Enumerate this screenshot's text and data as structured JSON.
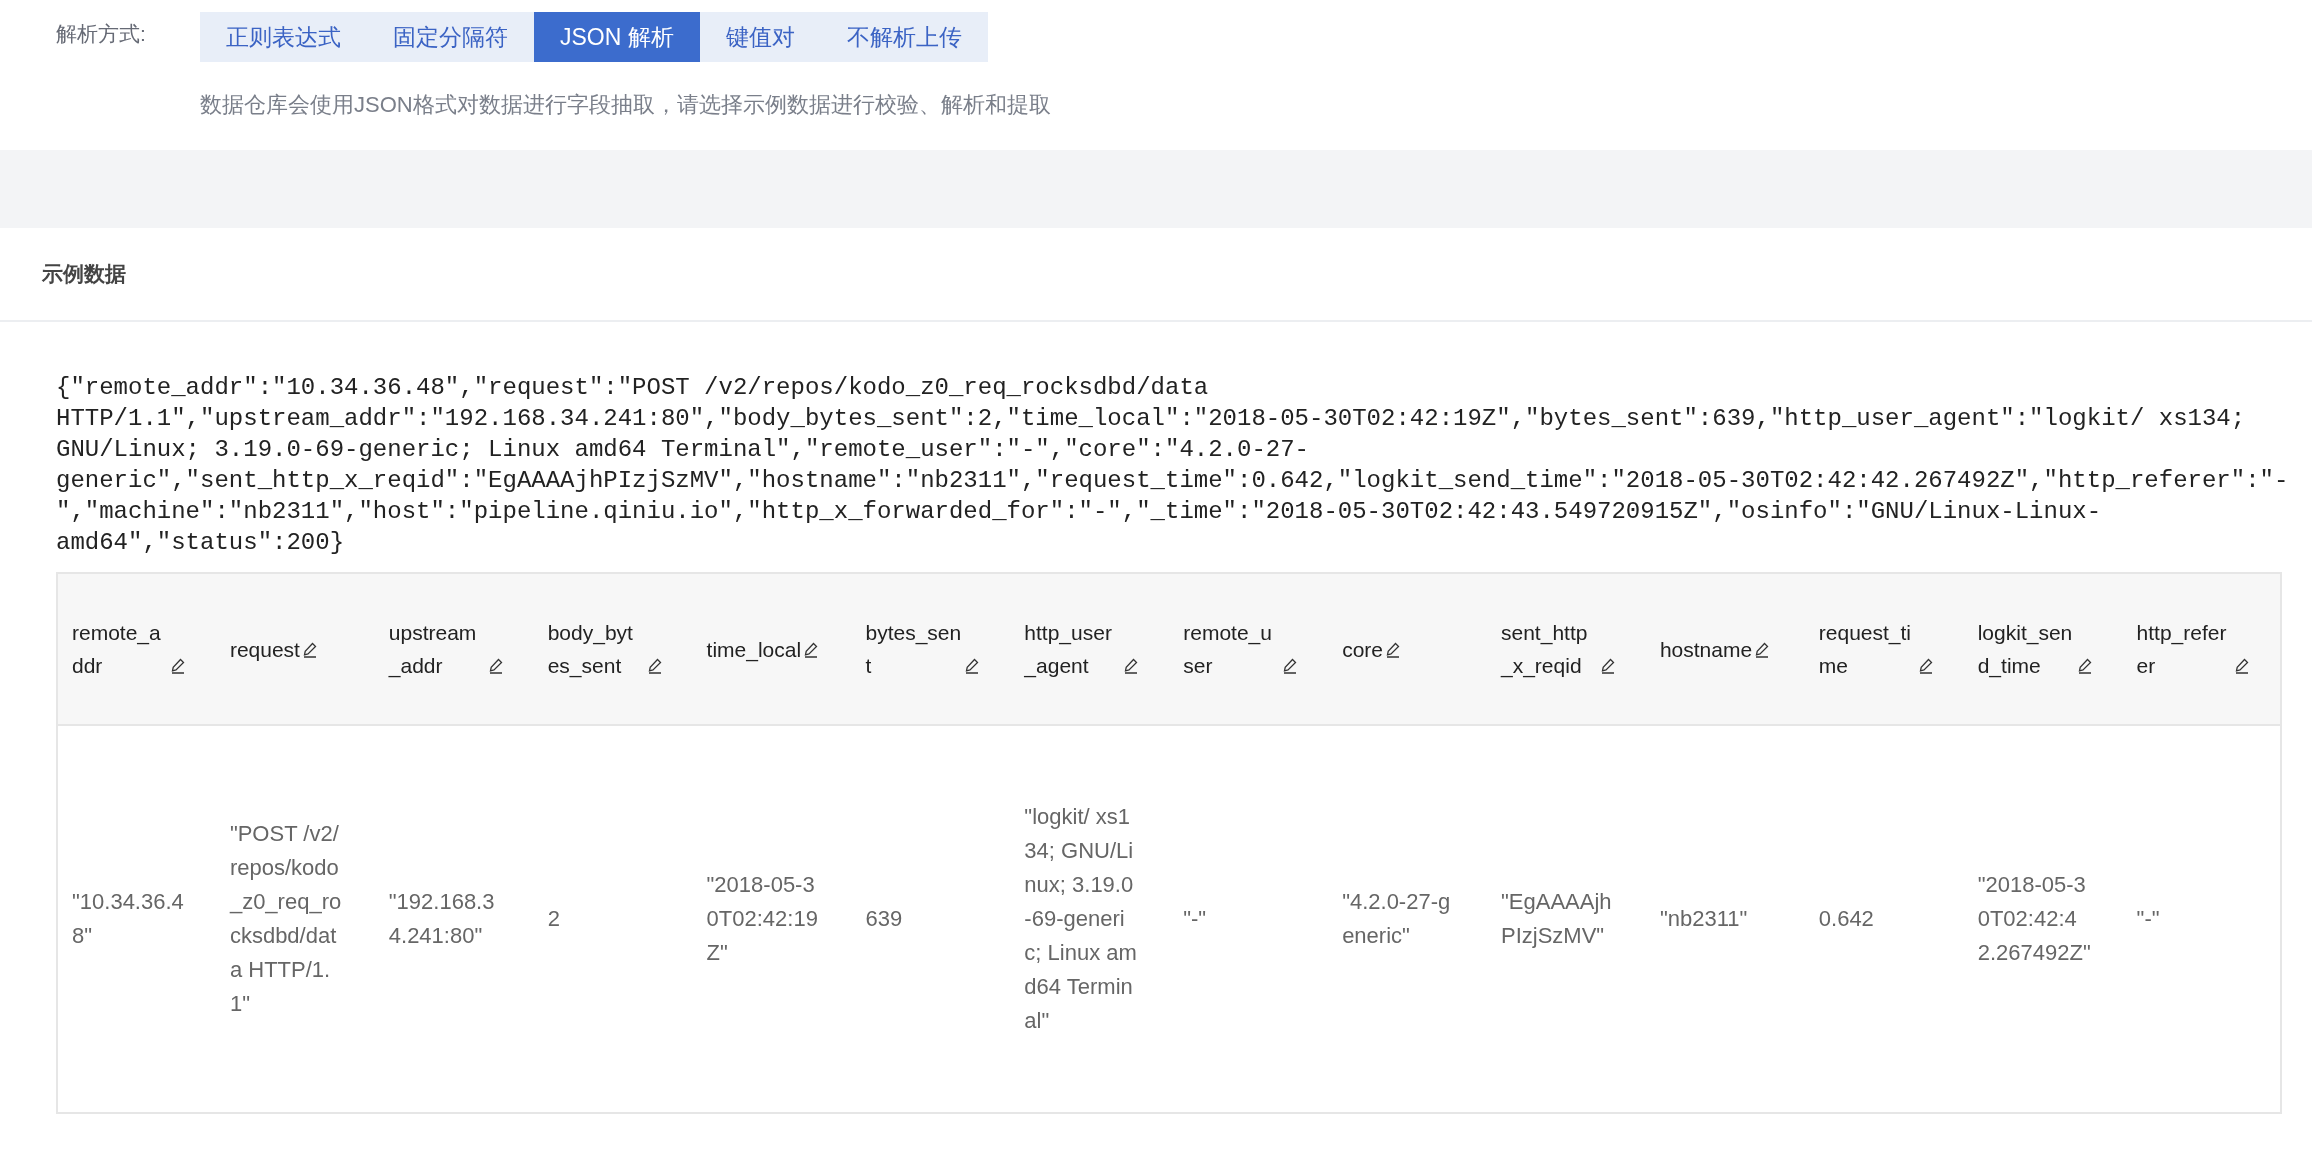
{
  "parse_mode": {
    "label": "解析方式:",
    "tabs": [
      {
        "label": "正则表达式",
        "selected": false
      },
      {
        "label": "固定分隔符",
        "selected": false
      },
      {
        "label": "JSON 解析",
        "selected": true
      },
      {
        "label": "键值对",
        "selected": false
      },
      {
        "label": "不解析上传",
        "selected": false
      }
    ],
    "description": "数据仓库会使用JSON格式对数据进行字段抽取，请选择示例数据进行校验、解析和提取"
  },
  "sample": {
    "title": "示例数据",
    "raw": "{\"remote_addr\":\"10.34.36.48\",\"request\":\"POST /v2/repos/kodo_z0_req_rocksdbd/data HTTP/1.1\",\"upstream_addr\":\"192.168.34.241:80\",\"body_bytes_sent\":2,\"time_local\":\"2018-05-30T02:42:19Z\",\"bytes_sent\":639,\"http_user_agent\":\"logkit/ xs134; GNU/Linux; 3.19.0-69-generic; Linux amd64 Terminal\",\"remote_user\":\"-\",\"core\":\"4.2.0-27-generic\",\"sent_http_x_reqid\":\"EgAAAAjhPIzjSzMV\",\"hostname\":\"nb2311\",\"request_time\":0.642,\"logkit_send_time\":\"2018-05-30T02:42:42.267492Z\",\"http_referer\":\"-\",\"machine\":\"nb2311\",\"host\":\"pipeline.qiniu.io\",\"http_x_forwarded_for\":\"-\",\"_time\":\"2018-05-30T02:42:43.549720915Z\",\"osinfo\":\"GNU/Linux-Linux-amd64\",\"status\":200}",
    "table": {
      "columns": [
        "remote_addr",
        "request",
        "upstream_addr",
        "body_bytes_sent",
        "time_local",
        "bytes_sent",
        "http_user_agent",
        "remote_user",
        "core",
        "sent_http_x_reqid",
        "hostname",
        "request_time",
        "logkit_send_time",
        "http_referer"
      ],
      "rows": [
        [
          "\"10.34.36.48\"",
          "\"POST /v2/repos/kodo_z0_req_rocksdbd/data HTTP/1.1\"",
          "\"192.168.34.241:80\"",
          "2",
          "\"2018-05-30T02:42:19Z\"",
          "639",
          "\"logkit/ xs134; GNU/Linux; 3.19.0-69-generic; Linux amd64 Terminal\"",
          "\"-\"",
          "\"4.2.0-27-generic\"",
          "\"EgAAAAjhPIzjSzMV\"",
          "\"nb2311\"",
          "0.642",
          "\"2018-05-30T02:42:42.267492Z\"",
          "\"-\""
        ]
      ]
    }
  }
}
